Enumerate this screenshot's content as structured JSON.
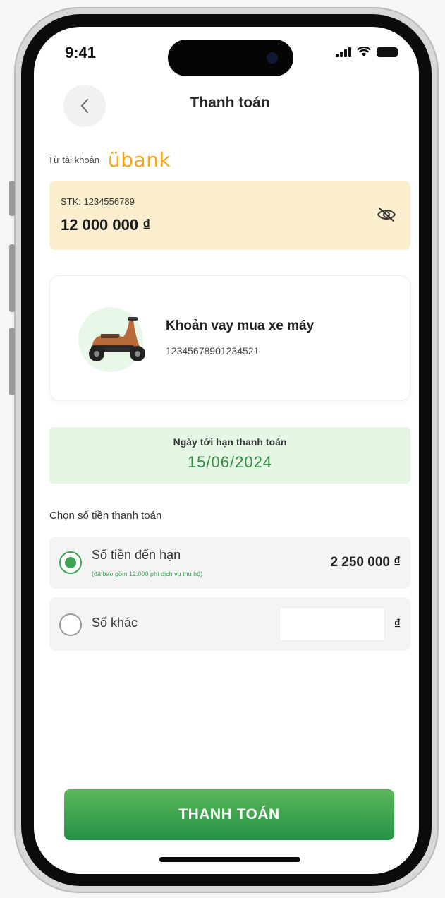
{
  "status_bar": {
    "time": "9:41"
  },
  "header": {
    "title": "Thanh toán",
    "back_icon": "chevron-left-icon"
  },
  "from_account": {
    "label": "Từ tài khoản",
    "brand": "übank",
    "stk": "STK: 1234556789",
    "balance": "12 000 000 ₫",
    "visibility_icon": "eye-off-icon"
  },
  "loan": {
    "name": "Khoản vay mua xe máy",
    "id": "12345678901234521",
    "image": "scooter-icon"
  },
  "due": {
    "label": "Ngày tới hạn thanh toán",
    "date": "15/06/2024"
  },
  "amount": {
    "label": "Chọn số tiền thanh toán",
    "options": [
      {
        "title": "Số tiền đến hạn",
        "note": "(đã bao gồm 12.000 phí dịch vụ thu hộ)",
        "value": "2 250 000 ₫",
        "selected": true
      },
      {
        "title": "Số khác",
        "value": "",
        "placeholder": "",
        "currency": "₫",
        "selected": false
      }
    ]
  },
  "actions": {
    "pay_label": "THANH TOÁN"
  },
  "colors": {
    "primary_green": "#3aa454",
    "brand_orange": "#f2a51b",
    "account_bg": "#fbefcf",
    "due_bg": "#e6f6e5"
  }
}
